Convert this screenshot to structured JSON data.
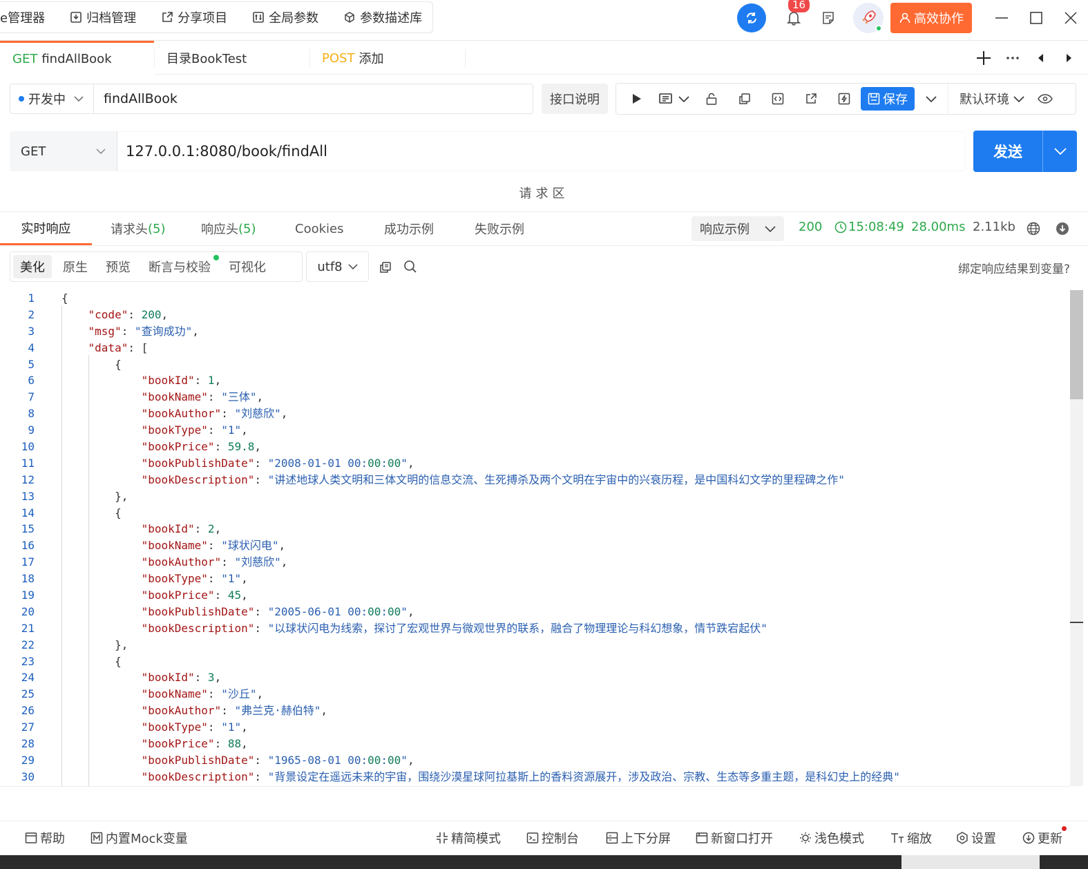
{
  "topmenu": {
    "items": [
      {
        "label": "e管理器",
        "icon": ""
      },
      {
        "label": "归档管理",
        "icon": "archive-icon"
      },
      {
        "label": "分享项目",
        "icon": "share-icon"
      },
      {
        "label": "全局参数",
        "icon": "params-icon"
      },
      {
        "label": "参数描述库",
        "icon": "cube-icon"
      }
    ],
    "notification_count": "16",
    "collab_label": "高效协作"
  },
  "tabs": [
    {
      "method": "GET",
      "label": "findAllBook"
    },
    {
      "method": "",
      "label": "目录BookTest"
    },
    {
      "method": "POST",
      "label": "添加"
    }
  ],
  "request": {
    "status": "开发中",
    "name": "findAllBook",
    "doc_label": "接口说明",
    "save_label": "保存",
    "env_label": "默认环境",
    "method": "GET",
    "url": "127.0.0.1:8080/book/findAll",
    "send_label": "发送",
    "area_label": "请求区"
  },
  "response": {
    "tabs": [
      {
        "label": "实时响应",
        "count": ""
      },
      {
        "label": "请求头",
        "count": "(5)"
      },
      {
        "label": "响应头",
        "count": "(5)"
      },
      {
        "label": "Cookies",
        "count": ""
      },
      {
        "label": "成功示例",
        "count": ""
      },
      {
        "label": "失败示例",
        "count": ""
      }
    ],
    "example_label": "响应示例",
    "status_code": "200",
    "time": "15:08:49",
    "duration": "28.00ms",
    "size": "2.11kb",
    "view_tabs": [
      "美化",
      "原生",
      "预览",
      "断言与校验",
      "可视化"
    ],
    "encoding": "utf8",
    "bind_label": "绑定响应结果到变量?"
  },
  "code_lines": [
    {
      "n": "1",
      "t": "{"
    },
    {
      "n": "2",
      "t": "    \"code\": 200,"
    },
    {
      "n": "3",
      "t": "    \"msg\": \"查询成功\","
    },
    {
      "n": "4",
      "t": "    \"data\": ["
    },
    {
      "n": "5",
      "t": "        {"
    },
    {
      "n": "6",
      "t": "            \"bookId\": 1,"
    },
    {
      "n": "7",
      "t": "            \"bookName\": \"三体\","
    },
    {
      "n": "8",
      "t": "            \"bookAuthor\": \"刘慈欣\","
    },
    {
      "n": "9",
      "t": "            \"bookType\": \"1\","
    },
    {
      "n": "10",
      "t": "            \"bookPrice\": 59.8,"
    },
    {
      "n": "11",
      "t": "            \"bookPublishDate\": \"2008-01-01 00:00:00\","
    },
    {
      "n": "12",
      "t": "            \"bookDescription\": \"讲述地球人类文明和三体文明的信息交流、生死搏杀及两个文明在宇宙中的兴衰历程，是中国科幻文学的里程碑之作\""
    },
    {
      "n": "13",
      "t": "        },"
    },
    {
      "n": "14",
      "t": "        {"
    },
    {
      "n": "15",
      "t": "            \"bookId\": 2,"
    },
    {
      "n": "16",
      "t": "            \"bookName\": \"球状闪电\","
    },
    {
      "n": "17",
      "t": "            \"bookAuthor\": \"刘慈欣\","
    },
    {
      "n": "18",
      "t": "            \"bookType\": \"1\","
    },
    {
      "n": "19",
      "t": "            \"bookPrice\": 45,"
    },
    {
      "n": "20",
      "t": "            \"bookPublishDate\": \"2005-06-01 00:00:00\","
    },
    {
      "n": "21",
      "t": "            \"bookDescription\": \"以球状闪电为线索，探讨了宏观世界与微观世界的联系，融合了物理理论与科幻想象，情节跌宕起伏\""
    },
    {
      "n": "22",
      "t": "        },"
    },
    {
      "n": "23",
      "t": "        {"
    },
    {
      "n": "24",
      "t": "            \"bookId\": 3,"
    },
    {
      "n": "25",
      "t": "            \"bookName\": \"沙丘\","
    },
    {
      "n": "26",
      "t": "            \"bookAuthor\": \"弗兰克·赫伯特\","
    },
    {
      "n": "27",
      "t": "            \"bookType\": \"1\","
    },
    {
      "n": "28",
      "t": "            \"bookPrice\": 88,"
    },
    {
      "n": "29",
      "t": "            \"bookPublishDate\": \"1965-08-01 00:00:00\","
    },
    {
      "n": "30",
      "t": "            \"bookDescription\": \"背景设定在遥远未来的宇宙，围绕沙漠星球阿拉基斯上的香料资源展开，涉及政治、宗教、生态等多重主题，是科幻史上的经典\""
    }
  ],
  "bottombar": [
    {
      "label": "帮助",
      "icon": "help-icon"
    },
    {
      "label": "内置Mock变量",
      "icon": "mock-icon"
    },
    {
      "label": "精简模式",
      "icon": "compact-icon"
    },
    {
      "label": "控制台",
      "icon": "console-icon"
    },
    {
      "label": "上下分屏",
      "icon": "split-icon"
    },
    {
      "label": "新窗口打开",
      "icon": "new-window-icon"
    },
    {
      "label": "浅色模式",
      "icon": "sun-icon"
    },
    {
      "label": "缩放",
      "icon": "font-size-icon"
    },
    {
      "label": "设置",
      "icon": "settings-icon"
    },
    {
      "label": "更新",
      "icon": "update-icon"
    }
  ],
  "colors": {
    "accent": "#1e7cf0",
    "orange": "#ff6a33",
    "get": "#2ba84a",
    "post": "#f5b017"
  }
}
